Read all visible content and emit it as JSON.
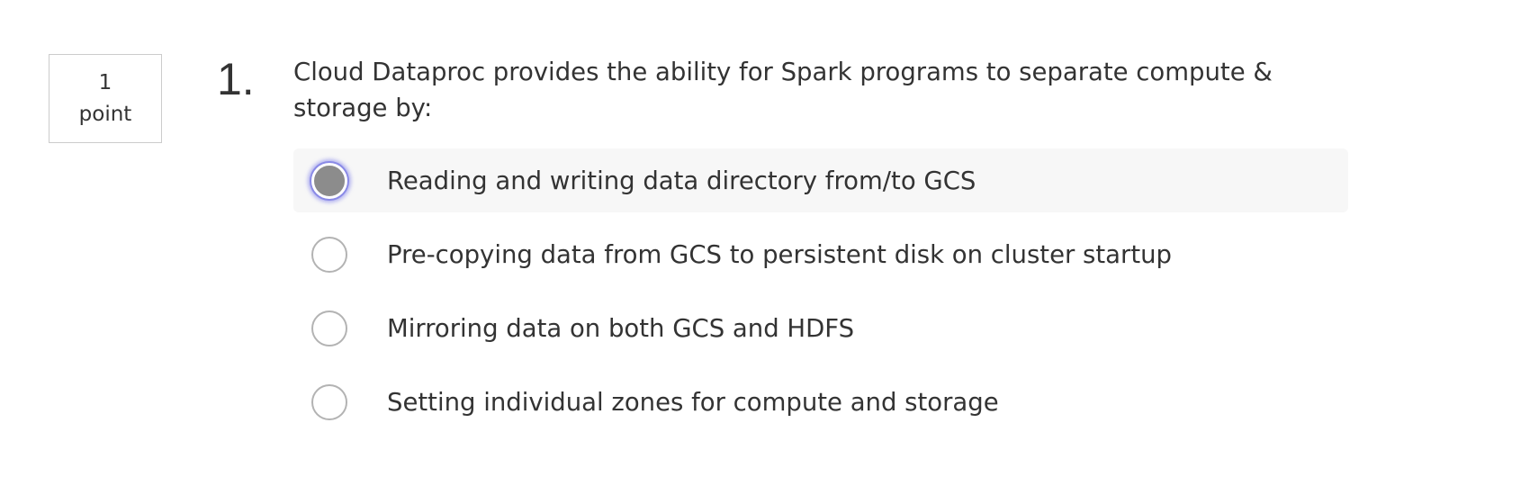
{
  "points": {
    "value": "1",
    "unit": "point"
  },
  "question": {
    "number": "1.",
    "text": "Cloud Dataproc provides the ability for Spark programs to separate compute & storage by:"
  },
  "options": [
    {
      "label": "Reading and writing data directory from/to GCS",
      "selected": true
    },
    {
      "label": "Pre-copying data from GCS to persistent disk on cluster startup",
      "selected": false
    },
    {
      "label": "Mirroring data on both GCS and HDFS",
      "selected": false
    },
    {
      "label": "Setting individual zones for compute and storage",
      "selected": false
    }
  ],
  "colors": {
    "text": "#333333",
    "selected_row_bg": "#f7f7f7",
    "radio_fill_selected": "#8c8c8c",
    "focus_ring": "#8a8ae6"
  }
}
